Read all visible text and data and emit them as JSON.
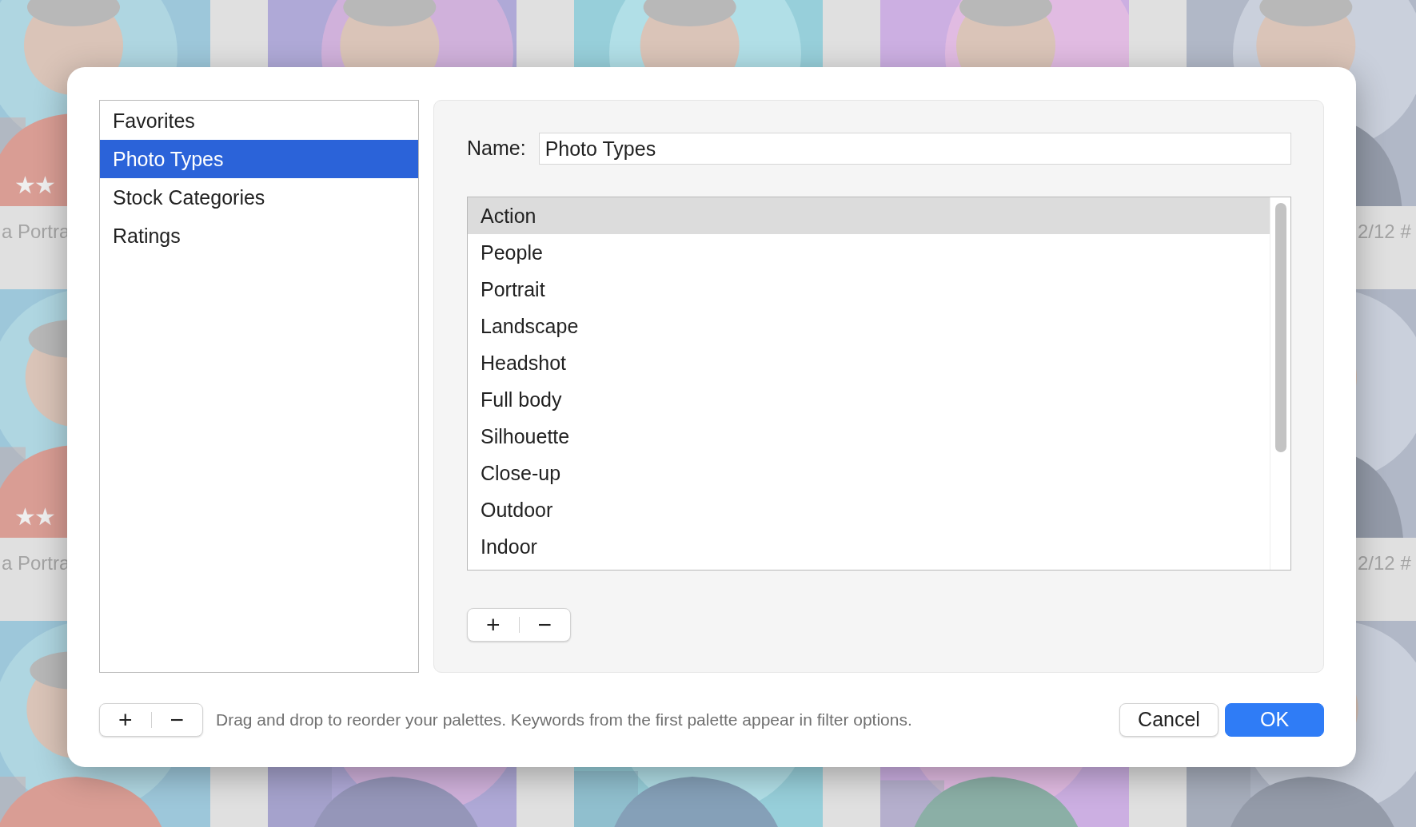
{
  "backdrop": {
    "rows": [
      [
        {
          "kind": "picture",
          "rating": "★★",
          "caption": "a Portra"
        },
        {
          "kind": "picture"
        },
        {
          "kind": "picture"
        },
        {
          "kind": "picture"
        },
        {
          "kind": "picture",
          "caption": "2/12 #"
        }
      ],
      [
        {
          "kind": "picture",
          "rating": "★★",
          "caption": "a Portra"
        },
        {
          "kind": "picture",
          "caption": "2/12 #"
        }
      ],
      [
        {
          "kind": "picture"
        },
        {
          "kind": "picture"
        },
        {
          "kind": "picture"
        },
        {
          "kind": "picture"
        },
        {
          "kind": "picture"
        }
      ]
    ]
  },
  "palettes": [
    {
      "label": "Favorites",
      "selected": false
    },
    {
      "label": "Photo Types",
      "selected": true
    },
    {
      "label": "Stock Categories",
      "selected": false
    },
    {
      "label": "Ratings",
      "selected": false
    }
  ],
  "editor": {
    "name_label": "Name:",
    "name_value": "Photo Types",
    "keywords": [
      {
        "label": "Action",
        "selected": true
      },
      {
        "label": "People",
        "selected": false
      },
      {
        "label": "Portrait",
        "selected": false
      },
      {
        "label": "Landscape",
        "selected": false
      },
      {
        "label": "Headshot",
        "selected": false
      },
      {
        "label": "Full body",
        "selected": false
      },
      {
        "label": "Silhouette",
        "selected": false
      },
      {
        "label": "Close-up",
        "selected": false
      },
      {
        "label": "Outdoor",
        "selected": false
      },
      {
        "label": "Indoor",
        "selected": false
      }
    ],
    "add": "+",
    "remove": "−"
  },
  "footer": {
    "add": "+",
    "remove": "−",
    "hint": "Drag and drop to reorder your palettes. Keywords from the first palette appear in filter options.",
    "buttons": [
      {
        "label": "Cancel",
        "kind": "default"
      },
      {
        "label": "OK",
        "kind": "primary"
      }
    ]
  }
}
